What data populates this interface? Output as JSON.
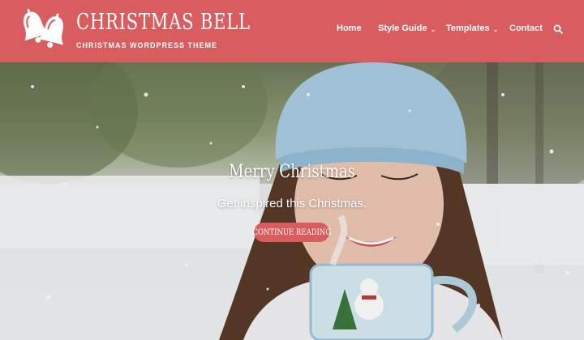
{
  "header": {
    "site_title": "CHRISTMAS BELL",
    "tagline": "CHRISTMAS WORDPRESS THEME",
    "logo_icon": "bells-icon",
    "background_color": "#d95c5f"
  },
  "nav": {
    "items": [
      {
        "label": "Home",
        "dropdown": false
      },
      {
        "label": "Style Guide",
        "dropdown": true
      },
      {
        "label": "Templates",
        "dropdown": true
      },
      {
        "label": "Contact",
        "dropdown": false
      }
    ],
    "search_icon": "search-icon"
  },
  "hero": {
    "title": "Merry Christmas",
    "subtitle": "Get inspired this Christmas.",
    "button_label": "CONTINUE READING",
    "button_color": "#d95c5f"
  }
}
